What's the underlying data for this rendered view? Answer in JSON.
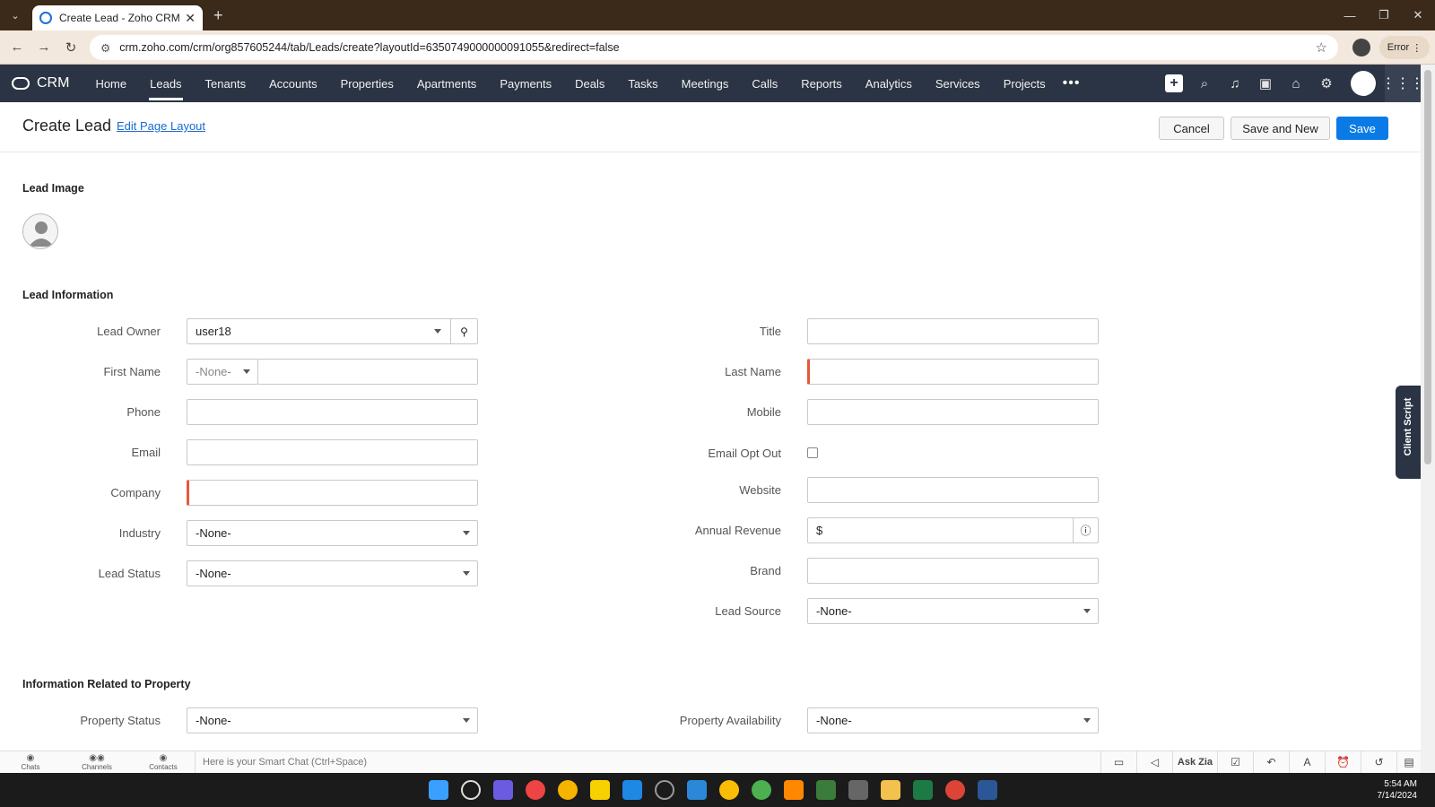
{
  "browser": {
    "tab_title": "Create Lead - Zoho CRM",
    "url": "crm.zoho.com/crm/org857605244/tab/Leads/create?layoutId=6350749000000091055&redirect=false",
    "error_label": "Error"
  },
  "crm": {
    "logo_text": "CRM",
    "nav": [
      "Home",
      "Leads",
      "Tenants",
      "Accounts",
      "Properties",
      "Apartments",
      "Payments",
      "Deals",
      "Tasks",
      "Meetings",
      "Calls",
      "Reports",
      "Analytics",
      "Services",
      "Projects"
    ],
    "active_nav": "Leads"
  },
  "page": {
    "title": "Create Lead",
    "edit_layout": "Edit Page Layout",
    "cancel": "Cancel",
    "save_and_new": "Save and New",
    "save": "Save"
  },
  "sections": {
    "image": "Lead Image",
    "info": "Lead Information",
    "property": "Information Related to Property"
  },
  "fields": {
    "lead_owner": {
      "label": "Lead Owner",
      "value": "user18"
    },
    "first_name": {
      "label": "First Name",
      "salutation": "-None-",
      "value": ""
    },
    "phone": {
      "label": "Phone"
    },
    "email": {
      "label": "Email"
    },
    "company": {
      "label": "Company"
    },
    "industry": {
      "label": "Industry",
      "value": "-None-"
    },
    "lead_status": {
      "label": "Lead Status",
      "value": "-None-"
    },
    "title": {
      "label": "Title"
    },
    "last_name": {
      "label": "Last Name"
    },
    "mobile": {
      "label": "Mobile"
    },
    "email_opt_out": {
      "label": "Email Opt Out"
    },
    "website": {
      "label": "Website"
    },
    "annual_revenue": {
      "label": "Annual Revenue",
      "prefix": "$"
    },
    "brand": {
      "label": "Brand"
    },
    "lead_source": {
      "label": "Lead Source",
      "value": "-None-"
    },
    "property_status": {
      "label": "Property Status",
      "value": "-None-"
    },
    "property_availability": {
      "label": "Property Availability",
      "value": "-None-"
    }
  },
  "side": {
    "client_script": "Client Script"
  },
  "bottom": {
    "chats": "Chats",
    "channels": "Channels",
    "contacts": "Contacts",
    "smart_chat": "Here is your Smart Chat (Ctrl+Space)",
    "ask_zia": "Ask Zia"
  },
  "taskbar": {
    "time": "5:54 AM",
    "date": "7/14/2024"
  }
}
